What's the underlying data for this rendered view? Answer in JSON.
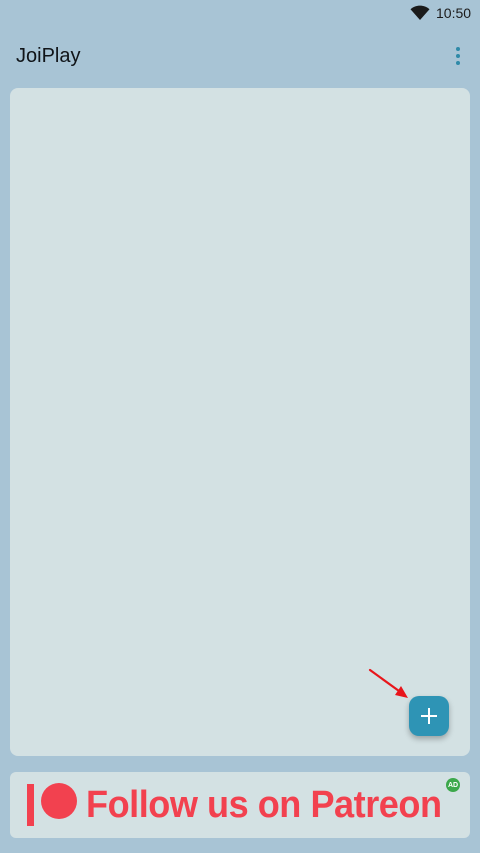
{
  "status_bar": {
    "time": "10:50",
    "wifi_icon": "wifi-icon"
  },
  "app_bar": {
    "title": "JoiPlay",
    "menu_icon": "more-vert-icon"
  },
  "fab": {
    "icon": "plus-icon",
    "accent_color": "#2e94b5"
  },
  "ad": {
    "text": "Follow us on Patreon",
    "badge": "AD",
    "logo_icon": "patreon-logo-icon",
    "text_color": "#f2414f"
  },
  "colors": {
    "background": "#a8c4d5",
    "card": "#d3e1e3"
  }
}
